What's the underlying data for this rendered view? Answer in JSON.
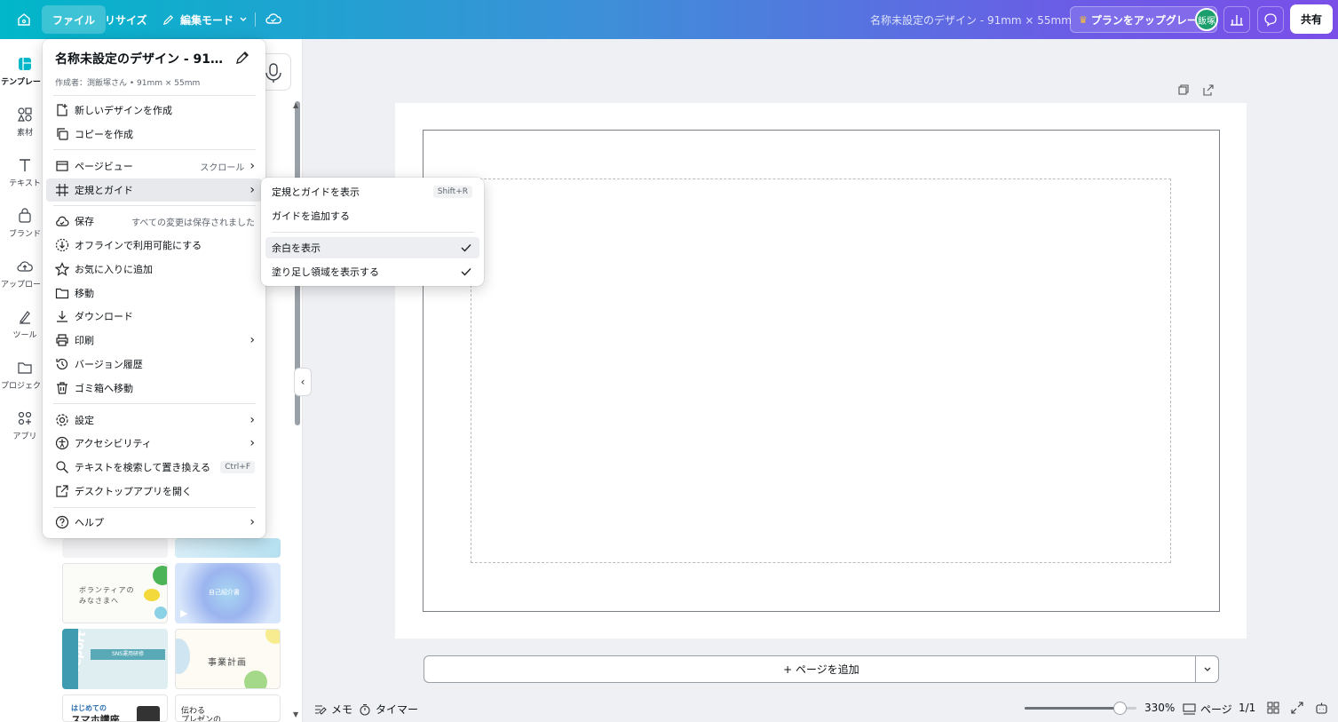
{
  "topbar": {
    "file": "ファイル",
    "resize": "リサイズ",
    "edit_mode": "編集モード",
    "doc_title": "名称未設定のデザイン - 91mm × 55mm",
    "upgrade": "プランをアップグレード",
    "avatar": "飯塚",
    "share": "共有",
    "accent_start": "#01b7c9",
    "accent_end": "#7a4fe8"
  },
  "rail": {
    "items": [
      {
        "label": "テンプレート",
        "icon": "template-icon"
      },
      {
        "label": "素材",
        "icon": "elements-icon"
      },
      {
        "label": "テキスト",
        "icon": "text-icon"
      },
      {
        "label": "ブランド",
        "icon": "brand-icon"
      },
      {
        "label": "アップロード",
        "icon": "upload-icon"
      },
      {
        "label": "ツール",
        "icon": "tools-icon"
      },
      {
        "label": "プロジェクト",
        "icon": "folder-icon"
      },
      {
        "label": "アプリ",
        "icon": "apps-icon"
      }
    ]
  },
  "file_menu": {
    "title": "名称未設定のデザイン - 91m...",
    "subtitle": "作成者：渕飯塚さん • 91mm × 55mm",
    "items": [
      {
        "label": "新しいデザインを作成",
        "icon": "plus-doc-icon"
      },
      {
        "label": "コピーを作成",
        "icon": "copy-icon"
      },
      {
        "label": "ページビュー",
        "icon": "page-view-icon",
        "right": "スクロール"
      },
      {
        "label": "定規とガイド",
        "icon": "grid-icon"
      },
      {
        "label": "保存",
        "icon": "cloud-check-icon",
        "right": "すべての変更は保存されました"
      },
      {
        "label": "オフラインで利用可能にする",
        "icon": "offline-icon"
      },
      {
        "label": "お気に入りに追加",
        "icon": "star-icon"
      },
      {
        "label": "移動",
        "icon": "folder-icon"
      },
      {
        "label": "ダウンロード",
        "icon": "download-icon"
      },
      {
        "label": "印刷",
        "icon": "print-icon"
      },
      {
        "label": "バージョン履歴",
        "icon": "history-icon"
      },
      {
        "label": "ゴミ箱へ移動",
        "icon": "trash-icon"
      },
      {
        "label": "設定",
        "icon": "settings-icon"
      },
      {
        "label": "アクセシビリティ",
        "icon": "accessibility-icon"
      },
      {
        "label": "テキストを検索して置き換える",
        "icon": "search-icon",
        "shortcut": "Ctrl+F"
      },
      {
        "label": "デスクトップアプリを開く",
        "icon": "external-link-icon"
      },
      {
        "label": "ヘルプ",
        "icon": "help-icon"
      }
    ]
  },
  "submenu": {
    "items": [
      {
        "label": "定規とガイドを表示",
        "shortcut": "Shift+R"
      },
      {
        "label": "ガイドを追加する"
      },
      {
        "label": "余白を表示",
        "checked": true
      },
      {
        "label": "塗り足し領域を表示する",
        "checked": true
      }
    ]
  },
  "canvas": {
    "add_page": "+ ページを追加"
  },
  "bottombar": {
    "notes": "メモ",
    "timer": "タイマー",
    "zoom": "330%",
    "zoom_level": 0.85,
    "pages_label": "ページ",
    "page_count": "1/1"
  },
  "thumbnails": [
    {
      "line1": "ボランティアの",
      "line2": "みなさまへ"
    },
    {
      "line1": "自己紹介書"
    },
    {
      "line1": "report",
      "line2": "SNS運用研修"
    },
    {
      "line1": "事業計画"
    },
    {
      "line1": "はじめての",
      "line2": "スマホ講座"
    },
    {
      "line1": "伝わる",
      "line2": "プレゼンの"
    }
  ]
}
